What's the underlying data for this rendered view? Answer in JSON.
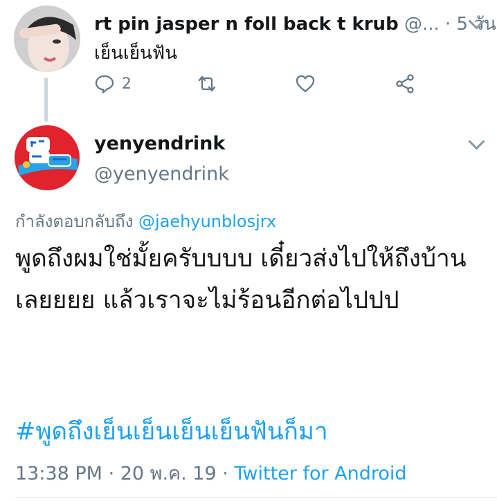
{
  "reply_tweet": {
    "display_name": "rt pin jasper n foll back t krub",
    "handle": "@...",
    "separator": " · ",
    "time": "5 วัน",
    "text": "เย็นเย็นฟัน",
    "actions": {
      "reply_count": "2",
      "icons": [
        "reply-icon",
        "retweet-icon",
        "like-icon",
        "share-icon"
      ]
    }
  },
  "main_tweet": {
    "display_name": "yenyendrink",
    "handle": "@yenyendrink",
    "replying_prefix": "กำลังตอบกลับถึง",
    "replying_to": "@jaehyunblosjrx",
    "body": "พูดถึงผมใช่มั้ยครับบบบ เดี๋ยวส่งไปให้ถึงบ้านเลยยยย แล้วเราจะไม่ร้อนอีกต่อไปปป",
    "hashtag": "#พูดถึงเย็นเย็นเย็นเย็นฟันก็มา",
    "timestamp": "13:38 PM",
    "date": "20 พ.ค. 19",
    "dot": " · ",
    "source": "Twitter for Android"
  },
  "colors": {
    "accent": "#1da1f2",
    "secondary_text": "#657786",
    "primary_text": "#14171a"
  }
}
